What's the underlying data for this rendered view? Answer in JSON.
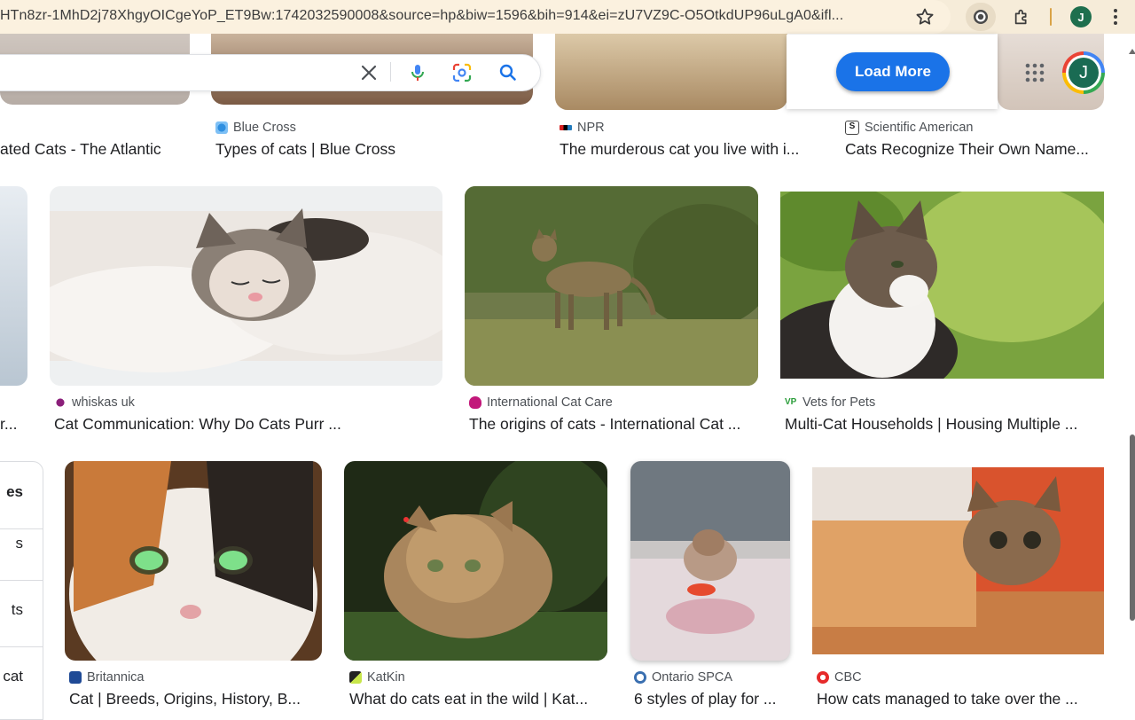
{
  "browser": {
    "url": "HTn8zr-1MhD2j78XhgyOICgeYoP_ET9Bw:1742032590008&source=hp&biw=1596&bih=914&ei=zU7VZ9C-O5OtkdUP96uLgA0&ifl...",
    "profile_initial": "J",
    "icons": [
      "star-icon",
      "extension-record-icon",
      "extensions-puzzle-icon",
      "kebab-menu-icon"
    ]
  },
  "search": {
    "icons": [
      "clear-icon",
      "voice-search-icon",
      "lens-icon",
      "search-icon"
    ]
  },
  "load_more": {
    "label": "Load More"
  },
  "account": {
    "initial": "J"
  },
  "top_row": [
    {
      "source": "",
      "caption": "ated Cats - The Atlantic"
    },
    {
      "source": "Blue Cross",
      "caption": "Types of cats | Blue Cross"
    },
    {
      "source": "NPR",
      "caption": "The murderous cat you live with i..."
    },
    {
      "source": "Scientific American",
      "caption": "Cats Recognize Their Own Name..."
    }
  ],
  "middle_row": [
    {
      "source": "",
      "caption": "r..."
    },
    {
      "source": "whiskas uk",
      "caption": "Cat Communication: Why Do Cats Purr ..."
    },
    {
      "source": "International Cat Care",
      "caption": "The origins of cats - International Cat ..."
    },
    {
      "source": "Vets for Pets",
      "caption": "Multi-Cat Households | Housing Multiple ..."
    }
  ],
  "bottom_row": [
    {
      "source": "Britannica",
      "caption": "Cat | Breeds, Origins, History, B..."
    },
    {
      "source": "KatKin",
      "caption": "What do cats eat in the wild | Kat..."
    },
    {
      "source": "Ontario SPCA",
      "caption": "6 styles of play for ..."
    },
    {
      "source": "CBC",
      "caption": "How cats managed to take over the ..."
    }
  ],
  "related": [
    "es",
    "s",
    "ts",
    "s cat"
  ],
  "colors": {
    "accent": "#1a73e8",
    "address_bar": "#fbf1df",
    "profile": "#1e6f4e"
  }
}
